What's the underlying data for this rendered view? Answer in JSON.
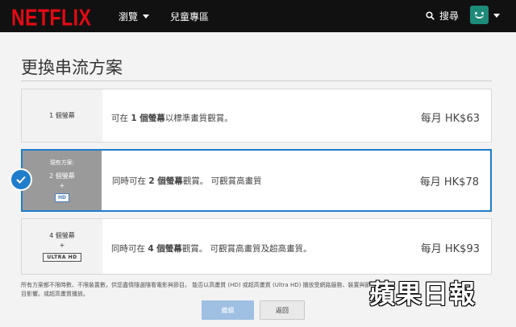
{
  "header": {
    "logo": "NETFLIX",
    "nav": {
      "browse": "瀏覽",
      "kids": "兒童專區"
    },
    "search_label": "搜尋",
    "colors": {
      "bar": "#111111",
      "logo": "#e50914"
    }
  },
  "page": {
    "title": "更換串流方案"
  },
  "plans": [
    {
      "screens": "1 個螢幕",
      "desc_pre": "可在 ",
      "desc_strong": "1 個螢幕",
      "desc_post": "以標準畫質觀賞。",
      "price": "每月 HK$63"
    },
    {
      "current_label": "現有方案:",
      "screens": "2 個螢幕",
      "plus": "+",
      "badge": "HD",
      "desc_pre": "同時可在 ",
      "desc_strong": "2 個螢幕",
      "desc_post": "觀賞。 可觀賞高畫質",
      "price": "每月 HK$78",
      "selected": true
    },
    {
      "screens": "4 個螢幕",
      "plus": "+",
      "badge": "ULTRA HD",
      "desc_pre": "同時可在 ",
      "desc_strong": "4 個螢幕",
      "desc_post": "觀賞。 可觀賞高畫質及超高畫質。",
      "price": "每月 HK$93"
    }
  ],
  "footnote": "所有方案都不限時數、不限裝置數，供您盡情隨選隨看電影與節目。 能否以高畫質 (HD) 或超高畫質 (Ultra HD) 播放受網路服務、裝置與節目影響。或超高畫質播放。",
  "buttons": {
    "continue": "繼續",
    "back": "返回"
  },
  "watermark": "蘋果日報",
  "accent_color": "#1f7dcc"
}
